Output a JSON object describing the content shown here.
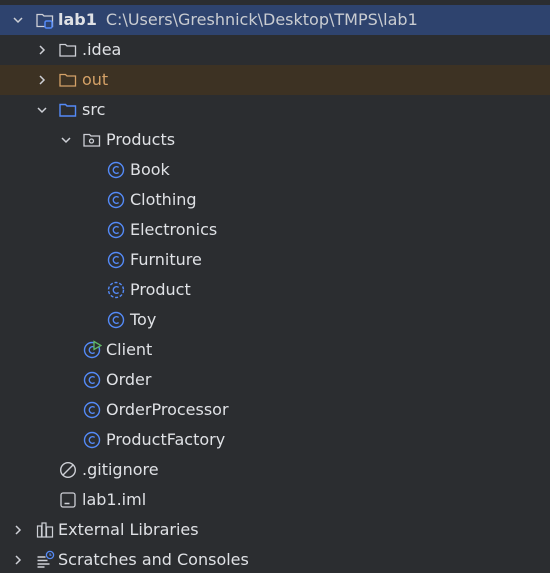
{
  "project_tree": {
    "root": {
      "name": "lab1",
      "path": "C:\\Users\\Greshnick\\Desktop\\TMPS\\lab1"
    },
    "idea": ".idea",
    "out": "out",
    "src": "src",
    "products_pkg": "Products",
    "products": [
      "Book",
      "Clothing",
      "Electronics",
      "Furniture",
      "Product",
      "Toy"
    ],
    "src_classes": [
      "Client",
      "Order",
      "OrderProcessor",
      "ProductFactory"
    ],
    "gitignore": ".gitignore",
    "iml": "lab1.iml",
    "external_libraries": "External Libraries",
    "scratches": "Scratches and Consoles"
  },
  "colors": {
    "selected_row": "#2e436e",
    "excluded_row": "#3d3223",
    "class_icon": "#548af7",
    "excluded_text": "#d4a167"
  }
}
